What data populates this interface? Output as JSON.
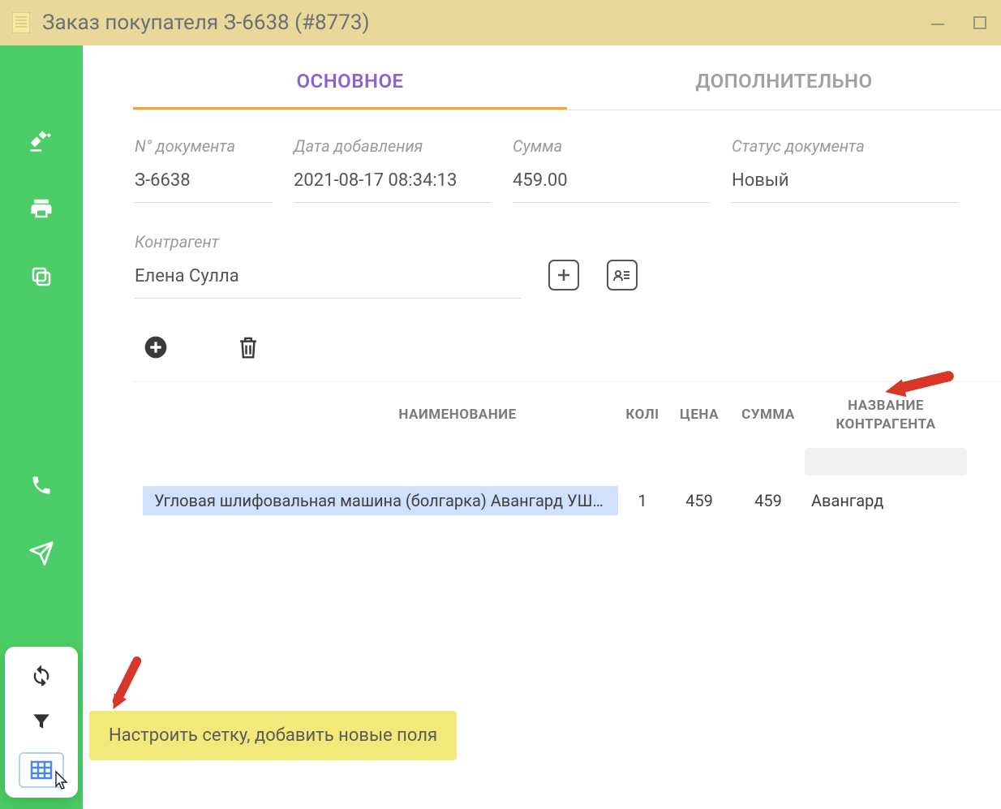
{
  "window": {
    "title": "Заказ покупателя З-6638 (#8773)"
  },
  "tabs": {
    "main": "ОСНОВНОЕ",
    "additional": "ДОПОЛНИТЕЛЬНО"
  },
  "fields": {
    "doc_number_label": "N° документа",
    "doc_number": "З-6638",
    "date_label": "Дата добавления",
    "date": "2021-08-17 08:34:13",
    "sum_label": "Сумма",
    "sum": "459.00",
    "status_label": "Статус документа",
    "status": "Новый",
    "counterparty_label": "Контрагент",
    "counterparty": "Елена Сулла"
  },
  "grid": {
    "headers": {
      "name": "НАИМЕНОВАНИЕ",
      "qty": "КОЛІ",
      "price": "ЦЕНА",
      "sum": "СУММА",
      "ctr": "НАЗВАНИЕ КОНТРАГЕНТА"
    },
    "rows": [
      {
        "name": "Угловая шлифовальная машина (болгарка) Авангард УШМ-…",
        "qty": "1",
        "price": "459",
        "sum": "459",
        "ctr": "Авангард"
      }
    ]
  },
  "tooltip": "Настроить сетку, добавить новые поля"
}
